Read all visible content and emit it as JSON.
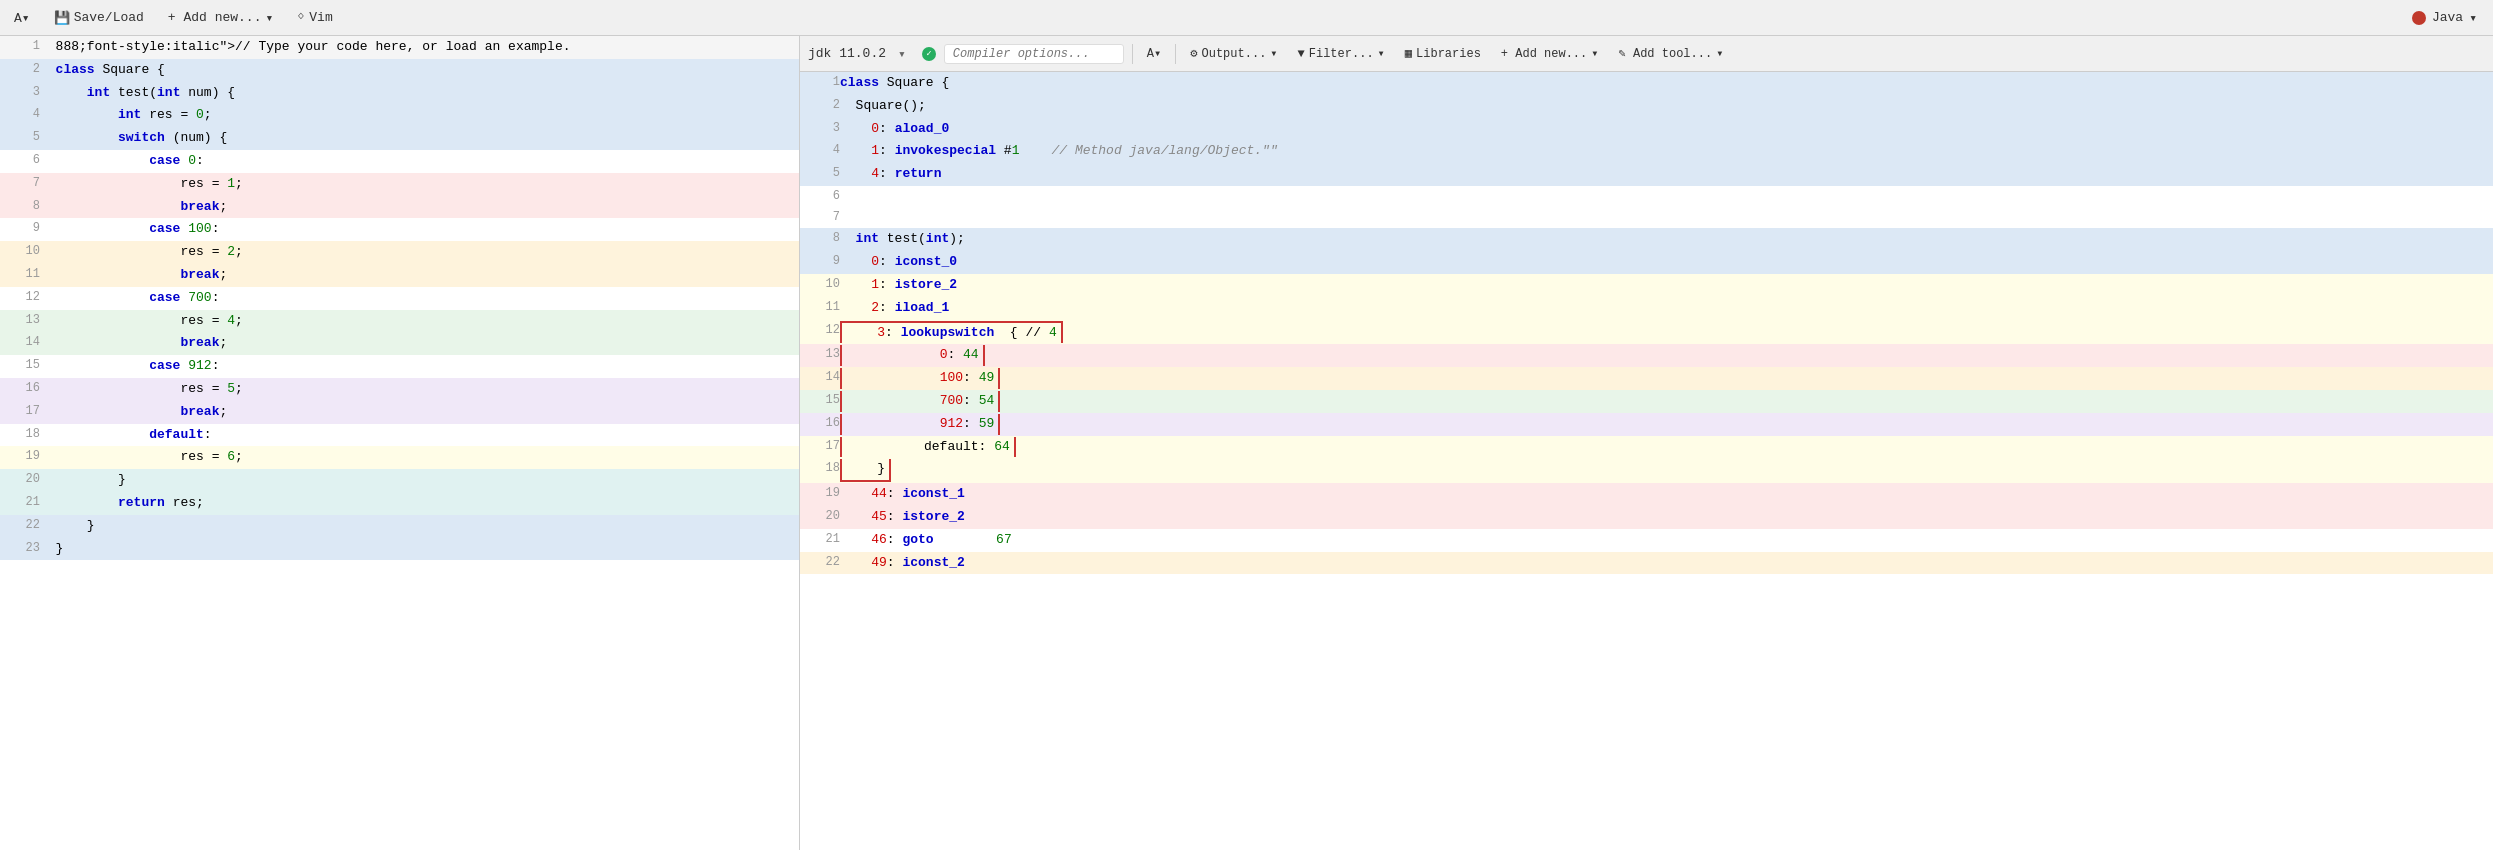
{
  "toolbar": {
    "font_size_label": "A▾",
    "save_load_label": "Save/Load",
    "add_new_label": "+ Add new...",
    "add_new_arrow": "▾",
    "vim_label": "Vim",
    "vim_icon": "ᛜ",
    "lang_java": "Java",
    "lang_arrow": "▾"
  },
  "output_toolbar": {
    "font_size_label": "A▾",
    "output_label": "Output...",
    "output_arrow": "▾",
    "filter_label": "Filter...",
    "filter_arrow": "▾",
    "libraries_label": "Libraries",
    "add_new_label": "+ Add new...",
    "add_new_arrow": "▾",
    "add_tool_label": "✎ Add tool...",
    "add_tool_arrow": "▾",
    "jdk_version": "jdk 11.0.2",
    "jdk_arrow": "▾",
    "compiler_placeholder": "Compiler options..."
  },
  "editor": {
    "lines": [
      {
        "num": 1,
        "bg": "comment",
        "code": "  // Type your code here, or load an example."
      },
      {
        "num": 2,
        "bg": "blue",
        "code": "  class Square {"
      },
      {
        "num": 3,
        "bg": "blue",
        "code": "      int test(int num) {"
      },
      {
        "num": 4,
        "bg": "blue",
        "code": "          int res = 0;"
      },
      {
        "num": 5,
        "bg": "blue",
        "code": "          switch (num) {"
      },
      {
        "num": 6,
        "bg": "white",
        "code": "              case 0:"
      },
      {
        "num": 7,
        "bg": "red",
        "code": "                  res = 1;"
      },
      {
        "num": 8,
        "bg": "red",
        "code": "                  break;"
      },
      {
        "num": 9,
        "bg": "white",
        "code": "              case 100:"
      },
      {
        "num": 10,
        "bg": "orange",
        "code": "                  res = 2;"
      },
      {
        "num": 11,
        "bg": "orange",
        "code": "                  break;"
      },
      {
        "num": 12,
        "bg": "white",
        "code": "              case 700:"
      },
      {
        "num": 13,
        "bg": "green",
        "code": "                  res = 4;"
      },
      {
        "num": 14,
        "bg": "green",
        "code": "                  break;"
      },
      {
        "num": 15,
        "bg": "white",
        "code": "              case 912:"
      },
      {
        "num": 16,
        "bg": "purple",
        "code": "                  res = 5;"
      },
      {
        "num": 17,
        "bg": "purple",
        "code": "                  break;"
      },
      {
        "num": 18,
        "bg": "white",
        "code": "              default:"
      },
      {
        "num": 19,
        "bg": "yellow",
        "code": "                  res = 6;"
      },
      {
        "num": 20,
        "bg": "teal",
        "code": "          }"
      },
      {
        "num": 21,
        "bg": "teal",
        "code": "          return res;"
      },
      {
        "num": 22,
        "bg": "blue",
        "code": "      }"
      },
      {
        "num": 23,
        "bg": "blue",
        "code": "  }"
      }
    ]
  },
  "output": {
    "lines": [
      {
        "num": 1,
        "bg": "blue",
        "indent": "",
        "code": "class Square {"
      },
      {
        "num": 2,
        "bg": "blue",
        "indent": "  ",
        "code": "Square();"
      },
      {
        "num": 3,
        "bg": "blue",
        "indent": "    ",
        "code": "0: aload_0"
      },
      {
        "num": 4,
        "bg": "blue",
        "indent": "    ",
        "code": "1: invokespecial #1",
        "comment": "// Method java/lang/Object.\"<init>\""
      },
      {
        "num": 5,
        "bg": "blue",
        "indent": "    ",
        "code": "4: return"
      },
      {
        "num": 6,
        "bg": "white",
        "indent": "",
        "code": ""
      },
      {
        "num": 7,
        "bg": "white",
        "indent": "",
        "code": ""
      },
      {
        "num": 8,
        "bg": "blue",
        "indent": "  ",
        "code": "int test(int);"
      },
      {
        "num": 9,
        "bg": "blue",
        "indent": "    ",
        "code": "0: iconst_0"
      },
      {
        "num": 10,
        "bg": "yellow",
        "indent": "    ",
        "code": "1: istore_2"
      },
      {
        "num": 11,
        "bg": "yellow",
        "indent": "    ",
        "code": "2: iload_1"
      },
      {
        "num": 12,
        "bg": "yellow",
        "indent": "    ",
        "code": "3: lookupswitch  { // 4",
        "boxed": true
      },
      {
        "num": 13,
        "bg": "red",
        "indent": "            ",
        "code": "0: 44",
        "boxed": true
      },
      {
        "num": 14,
        "bg": "orange",
        "indent": "            ",
        "code": "100: 49",
        "boxed": true
      },
      {
        "num": 15,
        "bg": "green",
        "indent": "            ",
        "code": "700: 54",
        "boxed": true
      },
      {
        "num": 16,
        "bg": "purple",
        "indent": "            ",
        "code": "912: 59",
        "boxed": true
      },
      {
        "num": 17,
        "bg": "yellow",
        "indent": "          ",
        "code": "default: 64",
        "boxed": true
      },
      {
        "num": 18,
        "bg": "yellow",
        "indent": "    ",
        "code": "}",
        "boxed": true
      },
      {
        "num": 19,
        "bg": "red",
        "indent": "    ",
        "code": "44: iconst_1"
      },
      {
        "num": 20,
        "bg": "red",
        "indent": "    ",
        "code": "45: istore_2"
      },
      {
        "num": 21,
        "bg": "white",
        "indent": "    ",
        "code": "46: goto        67"
      },
      {
        "num": 22,
        "bg": "orange",
        "indent": "    ",
        "code": "49: iconst_2"
      }
    ]
  }
}
